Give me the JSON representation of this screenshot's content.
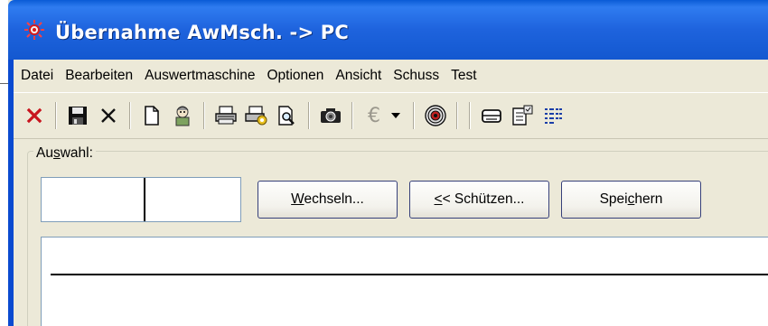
{
  "window": {
    "title": "Übernahme AwMsch. -> PC",
    "title_color": "#ffffff",
    "titlebar_color": "#1e63dd"
  },
  "menubar": {
    "items": [
      "Datei",
      "Bearbeiten",
      "Auswertmaschine",
      "Optionen",
      "Ansicht",
      "Schuss",
      "Test"
    ]
  },
  "toolbar": {
    "icons": [
      "close-red-x-icon",
      "save-disk-icon",
      "delete-x-icon",
      "new-document-icon",
      "wizard-icon",
      "print-icon",
      "print-setup-icon",
      "print-preview-icon",
      "camera-icon",
      "euro-icon",
      "dropdown-arrow-icon",
      "target-icon",
      "printer-icon",
      "properties-icon",
      "list-view-icon"
    ],
    "euro_symbol": "€"
  },
  "selection": {
    "group_label_prefix": "Au",
    "group_label_underline": "s",
    "group_label_suffix": "wahl:",
    "field_left_value": "",
    "field_right_value": "",
    "buttons": {
      "wechseln_accel": "W",
      "wechseln_rest": "echseln...",
      "schuetzen_accel": "<",
      "schuetzen_rest": "< Schützen...",
      "speichern_prefix": "Spei",
      "speichern_accel": "c",
      "speichern_suffix": "hern"
    }
  }
}
